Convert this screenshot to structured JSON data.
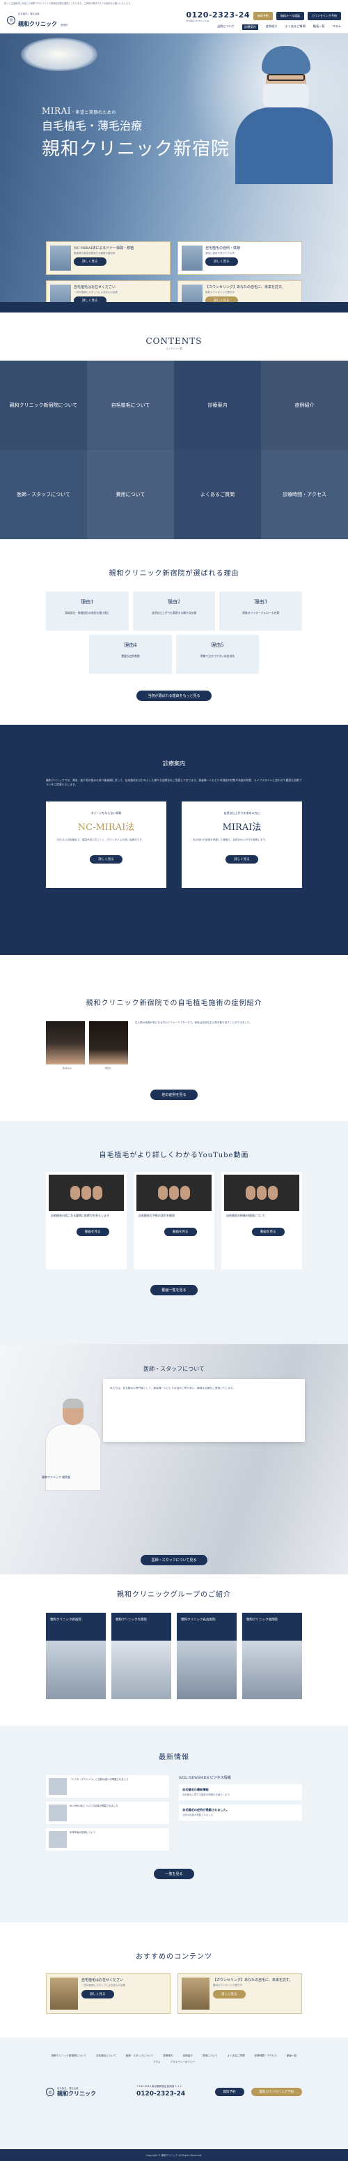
{
  "notice": "新しい生活様式に対応した新型コロナウイルス感染症対策を徹底しております。ご来院の際はマスクの着用をお願いいたします。",
  "header": {
    "logo_sub": "自毛植毛・薄毛治療",
    "logo_main": "親和クリニック",
    "logo_branch": "新宿院",
    "tel": "0120-2323-24",
    "tel_note": "受付時間 10:00〜19:00",
    "btn_reserve": "無料予約",
    "btn_mail": "無料メール相談",
    "btn_counsel": "カウンセリング予約",
    "nav": [
      "当院について",
      "診療案内",
      "症例紹介",
      "よくあるご質問",
      "動画一覧",
      "コラム"
    ]
  },
  "hero": {
    "line1": "MIRAI",
    "line1_small": "・希望と笑顔のための",
    "line2": "自毛植毛・薄毛治療",
    "line3": "親和クリニック新宿院",
    "cards": [
      {
        "title": "NC-MIRAI法によるドナー採取・移植",
        "sub": "患者様の負担を軽減する最新の植毛術",
        "btn": "詳しく見る"
      },
      {
        "title": "自毛植毛の症例・体験",
        "sub": "実際に施術を受けた方の声",
        "btn": "詳しく見る"
      },
      {
        "title": "自毛植毛はお任せください",
        "sub": "一流の医師とスタッフによる安心の治療",
        "btn": "詳しく見る"
      },
      {
        "title": "【カウンセリング】あなたの自毛に、未来を託す。",
        "sub": "無料カウンセリング受付中",
        "btn": "詳しく見る"
      }
    ]
  },
  "contents": {
    "title": "CONTENTS",
    "subtitle": "コンテンツ一覧",
    "tiles": [
      "親和クリニック新宿院について",
      "自毛植毛について",
      "診療案内",
      "症例紹介",
      "医師・スタッフについて",
      "費用について",
      "よくあるご質問",
      "診療時間・アクセス"
    ]
  },
  "reasons": {
    "title": "親和クリニック新宿院が選ばれる理由",
    "items": [
      {
        "title": "理由1",
        "desc": "採取部位・移植部位の負担を最小限に"
      },
      {
        "title": "理由2",
        "desc": "自然な仕上がりを実現する確かな技術"
      },
      {
        "title": "理由3",
        "desc": "術後のアフターフォローも充実"
      },
      {
        "title": "理由4",
        "desc": "豊富な症例実績"
      },
      {
        "title": "理由5",
        "desc": "明瞭で分かりやすい料金体系"
      }
    ],
    "btn": "当院が選ばれる理由をもっと見る"
  },
  "guide": {
    "title": "診療案内",
    "body": "親和クリニックでは、薄毛・抜け毛の悩みを持つ患者様に対して、自毛植毛をはじめとした様々な治療法をご用意しております。患者様一人ひとりの頭皮の状態や毛髪の状態、ライフスタイルに合わせて最適な治療プランをご提案いたします。",
    "cards": [
      {
        "pre": "ダメージを与えない採取",
        "name": "NC-MIRAI法",
        "desc": "切らない自毛植毛で、傷跡が目立ちにくく、ダウンタイムも短い治療法です。",
        "btn": "詳しく見る"
      },
      {
        "pre": "自然な仕上がりを求める方に",
        "name": "MIRAI法",
        "desc": "毛の流れや密度を考慮した移植で、自然な仕上がりを実現します。",
        "btn": "詳しく見る"
      }
    ]
  },
  "cases": {
    "title": "親和クリニック新宿院での自毛植毛施術の症例紹介",
    "before": "Before",
    "after": "After",
    "text": "生え際の後退が気になる方のビフォーアフターです。術後は自然な生え際を取り戻すことができました。",
    "btn": "他の症例を見る"
  },
  "videos": {
    "title": "自毛植毛がより詳しくわかるYouTube動画",
    "items": [
      {
        "title": "自毛植毛の気になる疑問に医師がお答えします",
        "btn": "動画を見る"
      },
      {
        "title": "自毛植毛の手術の流れを解説",
        "btn": "動画を見る"
      },
      {
        "title": "自毛植毛の術後の経過について",
        "btn": "動画を見る"
      }
    ],
    "btn": "動画一覧を見る"
  },
  "doctor": {
    "title": "医師・スタッフについて",
    "body": "私たちは、自毛植毛の専門家として、患者様一人ひとりの悩みに寄り添い、最適な治療をご提案いたします。",
    "name": "親和クリニック 総院長",
    "btn": "医師・スタッフについて見る"
  },
  "group": {
    "title": "親和クリニックグループのご紹介",
    "clinics": [
      "親和クリニック新宿院",
      "親和クリニック大阪院",
      "親和クリニック名古屋院",
      "親和クリニック福岡院"
    ]
  },
  "news": {
    "title": "最新情報",
    "items": [
      "「ドクターズファイル」に当院の紹介が掲載されました",
      "NC-MIRAI法についての記事が掲載されました",
      "年末年始の診療について"
    ],
    "col2_title": "SEIL NEWSWEB ビジネス情報",
    "col2_items": [
      {
        "title": "自毛植毛の最新情報",
        "desc": "自毛植毛に関する最新の情報をお届けします。"
      },
      {
        "title": "自毛植毛の症例が掲載されました。",
        "desc": "当院の症例が掲載されました。"
      }
    ],
    "btn": "一覧を見る"
  },
  "reco": {
    "title": "おすすめのコンテンツ",
    "cards": [
      {
        "title": "自毛植毛はお任せください",
        "sub": "一流の医師とスタッフによる安心の治療",
        "btn": "詳しく見る"
      },
      {
        "title": "【カウンセリング】あなたの自毛に、未来を託す。",
        "sub": "無料カウンセリング受付中",
        "btn": "詳しく見る"
      }
    ]
  },
  "footer": {
    "nav": [
      "親和クリニック新宿院について",
      "自毛植毛について",
      "医師・スタッフについて",
      "診療案内",
      "症例紹介",
      "費用について",
      "よくあるご質問",
      "診療時間・アクセス",
      "動画一覧",
      "コラム",
      "プライバシーポリシー"
    ],
    "address": "〒160-0023 東京都新宿区西新宿 1-1-1",
    "tel": "0120-2323-24",
    "btn_reserve": "無料予約",
    "btn_counsel": "無料カウンセリング予約",
    "copyright": "Copyright © 親和クリニック All Rights Reserved."
  }
}
